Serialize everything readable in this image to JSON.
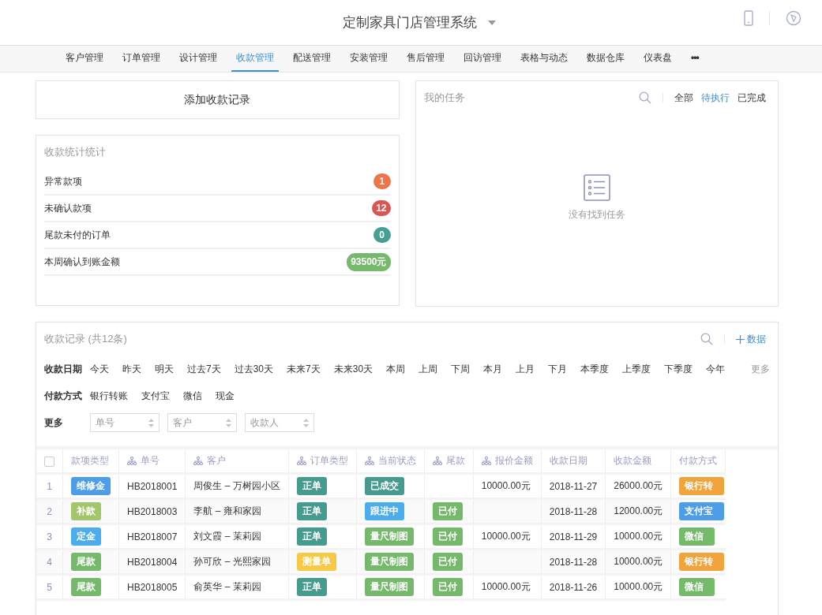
{
  "header": {
    "title": "定制家具门店管理系统"
  },
  "nav": {
    "items": [
      {
        "label": "客户管理",
        "selected": false
      },
      {
        "label": "订单管理",
        "selected": false
      },
      {
        "label": "设计管理",
        "selected": false
      },
      {
        "label": "收款管理",
        "selected": true
      },
      {
        "label": "配送管理",
        "selected": false
      },
      {
        "label": "安装管理",
        "selected": false
      },
      {
        "label": "售后管理",
        "selected": false
      },
      {
        "label": "回访管理",
        "selected": false
      },
      {
        "label": "表格与动态",
        "selected": false
      },
      {
        "label": "数据仓库",
        "selected": false
      },
      {
        "label": "仪表盘",
        "selected": false
      }
    ],
    "more": "•••"
  },
  "add_button": "添加收款记录",
  "stats": {
    "title": "收款统计统计",
    "items": [
      {
        "label": "异常款项",
        "value": "1",
        "color": "#ee7548"
      },
      {
        "label": "未确认款项",
        "value": "12",
        "color": "#dc5553"
      },
      {
        "label": "尾款未付的订单",
        "value": "0",
        "color": "#479e95"
      },
      {
        "label": "本周确认到账金额",
        "value": "93500元",
        "color": "#76b86c"
      }
    ]
  },
  "tasks": {
    "title": "我的任务",
    "filters": [
      {
        "label": "全部",
        "selected": false
      },
      {
        "label": "待执行",
        "selected": true
      },
      {
        "label": "已完成",
        "selected": false
      }
    ],
    "empty_text": "没有找到任务"
  },
  "records": {
    "title": "收款记录 (共12条)",
    "add_label": "数据",
    "filters": [
      {
        "label": "收款日期",
        "options": [
          "今天",
          "昨天",
          "明天",
          "过去7天",
          "过去30天",
          "未来7天",
          "未来30天",
          "本周",
          "上周",
          "下周",
          "本月",
          "上月",
          "下月",
          "本季度",
          "上季度",
          "下季度",
          "今年"
        ],
        "more": "更多"
      },
      {
        "label": "付款方式",
        "options": [
          "银行转账",
          "支付宝",
          "微信",
          "现金"
        ]
      }
    ],
    "more_filter": {
      "label": "更多",
      "fields": [
        {
          "placeholder": "单号"
        },
        {
          "placeholder": "客户"
        },
        {
          "placeholder": "收款人"
        }
      ]
    },
    "table": {
      "select_all": {
        "checked": false
      },
      "columns": [
        {
          "label": "款项类型",
          "kind": "plain"
        },
        {
          "label": "单号",
          "kind": "grouped"
        },
        {
          "label": "客户",
          "kind": "grouped"
        },
        {
          "label": "订单类型",
          "kind": "grouped"
        },
        {
          "label": "当前状态",
          "kind": "grouped"
        },
        {
          "label": "尾款",
          "kind": "grouped"
        },
        {
          "label": "报价金额",
          "kind": "grouped"
        },
        {
          "label": "收款日期",
          "kind": "plain"
        },
        {
          "label": "收款金额",
          "kind": "plain"
        },
        {
          "label": "付款方式",
          "kind": "plain"
        }
      ],
      "rows": [
        {
          "index": "1",
          "type": {
            "text": "维修金",
            "color": "#4d9de8"
          },
          "number": "HB2018001",
          "customer": "周俊生 – 万树园小区",
          "order_type": {
            "text": "正单",
            "color": "#459c8e"
          },
          "status": {
            "text": "已成交",
            "color": "#459c8e"
          },
          "quote": "10000.00元",
          "date": "2018-11-27",
          "amount": "26000.00元",
          "payment": {
            "text": "银行转",
            "color": "#f2a43c"
          }
        },
        {
          "index": "2",
          "type": {
            "text": "补款",
            "color": "#a2c66c"
          },
          "number": "HB2018003",
          "customer": "李航 – 雍和家园",
          "order_type": {
            "text": "正单",
            "color": "#459c8e"
          },
          "status": {
            "text": "跟进中",
            "color": "#4badec"
          },
          "balance": {
            "text": "已付",
            "color": "#76b86c"
          },
          "date": "2018-11-28",
          "amount": "12000.00元",
          "payment": {
            "text": "支付宝",
            "color": "#4d9de8"
          }
        },
        {
          "index": "3",
          "type": {
            "text": "定金",
            "color": "#4badec"
          },
          "number": "HB2018007",
          "customer": "刘文霞 – 茉莉园",
          "order_type": {
            "text": "正单",
            "color": "#459c8e"
          },
          "status": {
            "text": "量尺制图",
            "color": "#76b86c"
          },
          "balance": {
            "text": "已付",
            "color": "#76b86c"
          },
          "quote": "10000.00元",
          "date": "2018-11-29",
          "amount": "10000.00元",
          "payment": {
            "text": "微信",
            "color": "#76b86c"
          }
        },
        {
          "index": "4",
          "type": {
            "text": "尾款",
            "color": "#76b86c"
          },
          "number": "HB2018004",
          "customer": "孙可欣 – 光熙家园",
          "order_type": {
            "text": "测量单",
            "color": "#f8c946"
          },
          "status": {
            "text": "量尺制图",
            "color": "#76b86c"
          },
          "balance": {
            "text": "已付",
            "color": "#76b86c"
          },
          "date": "2018-11-28",
          "amount": "10000.00元",
          "payment": {
            "text": "银行转",
            "color": "#f2a43c"
          }
        },
        {
          "index": "5",
          "type": {
            "text": "尾款",
            "color": "#76b86c"
          },
          "number": "HB2018005",
          "customer": "俞英华 – 茉莉园",
          "order_type": {
            "text": "正单",
            "color": "#459c8e"
          },
          "status": {
            "text": "量尺制图",
            "color": "#76b86c"
          },
          "balance": {
            "text": "已付",
            "color": "#76b86c"
          },
          "quote": "10000.00元",
          "date": "2018-11-26",
          "amount": "10000.00元",
          "payment": {
            "text": "微信",
            "color": "#76b86c"
          }
        }
      ]
    }
  }
}
